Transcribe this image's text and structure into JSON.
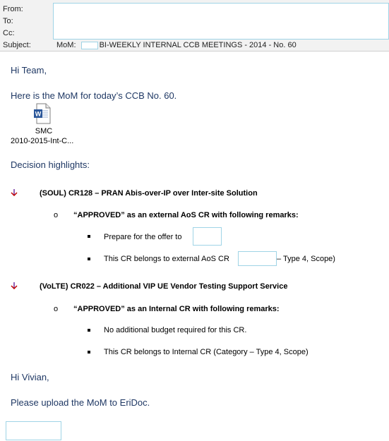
{
  "header": {
    "from_label": "From:",
    "to_label": "To:",
    "cc_label": "Cc:",
    "subject_label": "Subject:",
    "subject_prefix": "MoM:",
    "subject_text": "BI-WEEKLY INTERNAL CCB MEETINGS - 2014 - No. 60"
  },
  "body": {
    "greeting": "Hi Team,",
    "intro": "Here is the MoM for today’s CCB No. 60.",
    "attachment": {
      "name_line1": "SMC",
      "name_line2": "2010-2015-Int-C...",
      "icon": "word-document-icon"
    },
    "highlights_heading": "Decision highlights:",
    "items": [
      {
        "title": "(SOUL) CR128 – PRAN Abis-over-IP over Inter-site Solution",
        "status": "“APPROVED” as an external AoS CR with following remarks:",
        "remarks": [
          "Prepare for the offer to",
          "This CR belongs to external AoS CR",
          "– Type 4, Scope)"
        ]
      },
      {
        "title": "(VoLTE) CR022 – Additional VIP UE Vendor Testing Support Service",
        "status": "“APPROVED” as an Internal CR with following remarks:",
        "remarks": [
          "No additional budget required for this CR.",
          "This CR belongs to Internal CR (Category – Type 4, Scope)"
        ]
      }
    ],
    "closing_greeting": "Hi Vivian,",
    "closing_text": "Please upload the MoM to EriDoc."
  }
}
